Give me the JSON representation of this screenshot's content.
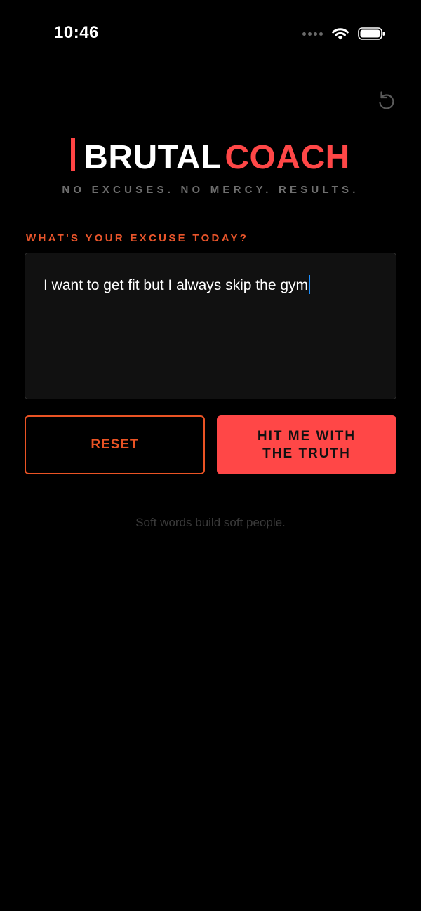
{
  "status_bar": {
    "time": "10:46",
    "icons": [
      "signal-dots-icon",
      "wifi-icon",
      "battery-icon"
    ]
  },
  "header": {
    "reset_icon": "rotate-ccw-icon"
  },
  "brand": {
    "word_1": "BRUTAL",
    "word_2": "COACH",
    "tagline": "NO EXCUSES. NO MERCY. RESULTS."
  },
  "form": {
    "prompt_label": "WHAT'S YOUR EXCUSE TODAY?",
    "excuse_value": "I want to get fit but I always skip the gym",
    "reset_label": "RESET",
    "submit_label": "HIT ME WITH THE TRUTH"
  },
  "footer": {
    "quote": "Soft words build soft people."
  },
  "colors": {
    "background": "#000000",
    "accent_red": "#ff4747",
    "accent_orange": "#ea5324",
    "input_bg": "#111111",
    "muted_text": "#6f6f6f"
  }
}
